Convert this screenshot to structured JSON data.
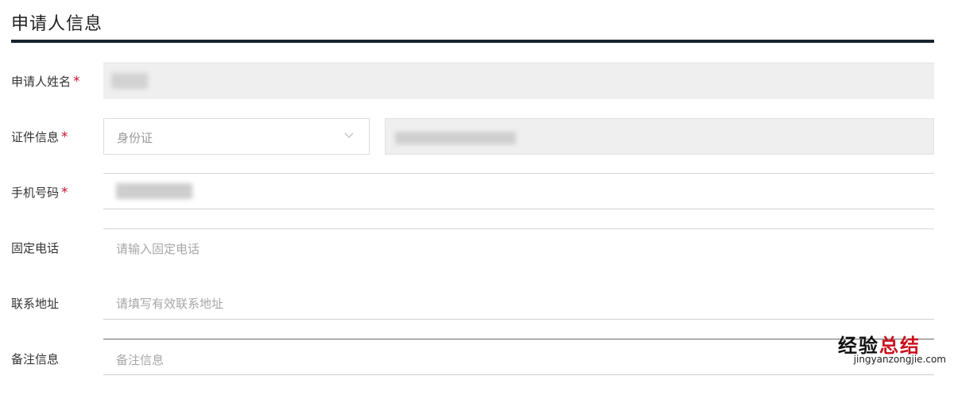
{
  "section": {
    "title": "申请人信息"
  },
  "form": {
    "name": {
      "label": "申请人姓名",
      "required_mark": "*"
    },
    "id_info": {
      "label": "证件信息",
      "required_mark": "*",
      "id_type_selected": "身份证"
    },
    "phone": {
      "label": "手机号码",
      "required_mark": "*"
    },
    "landline": {
      "label": "固定电话",
      "placeholder": "请输入固定电话"
    },
    "address": {
      "label": "联系地址",
      "placeholder": "请填写有效联系地址"
    },
    "remarks": {
      "label": "备注信息",
      "placeholder": "备注信息"
    }
  },
  "watermark": {
    "brand_part1": "经验",
    "brand_part2": "总结",
    "url": "jingyanzongjie.com"
  },
  "colors": {
    "title_rule": "#17232d",
    "required": "#c8102e",
    "readonly_bg": "#efefef",
    "placeholder": "#a7a7a7"
  }
}
